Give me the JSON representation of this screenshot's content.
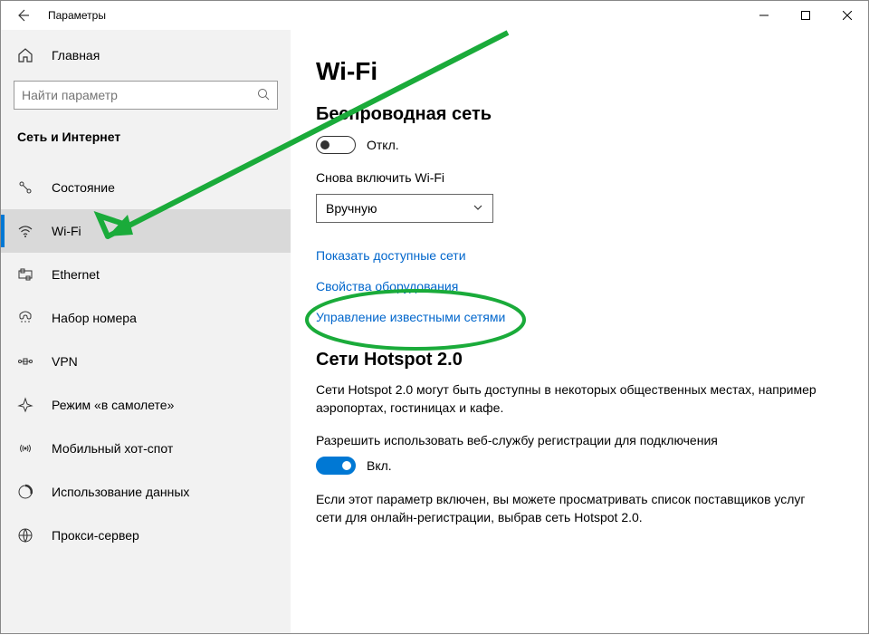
{
  "window_title": "Параметры",
  "home_label": "Главная",
  "search_placeholder": "Найти параметр",
  "section": "Сеть и Интернет",
  "sidebar": {
    "items": [
      {
        "label": "Состояние"
      },
      {
        "label": "Wi-Fi"
      },
      {
        "label": "Ethernet"
      },
      {
        "label": "Набор номера"
      },
      {
        "label": "VPN"
      },
      {
        "label": "Режим «в самолете»"
      },
      {
        "label": "Мобильный хот-спот"
      },
      {
        "label": "Использование данных"
      },
      {
        "label": "Прокси-сервер"
      }
    ]
  },
  "page": {
    "title": "Wi-Fi",
    "wireless_heading": "Беспроводная сеть",
    "wireless_toggle_state": "Откл.",
    "reconnect_label": "Снова включить Wi-Fi",
    "reconnect_value": "Вручную",
    "link_available": "Показать доступные сети",
    "link_hardware": "Свойства оборудования",
    "link_known": "Управление известными сетями",
    "hotspot_heading": "Сети Hotspot 2.0",
    "hotspot_intro": "Сети Hotspot 2.0 могут быть доступны в некоторых общественных местах, например аэропортах, гостиницах и кафе.",
    "hotspot_allow_label": "Разрешить использовать веб-службу регистрации для подключения",
    "hotspot_toggle_state": "Вкл.",
    "hotspot_desc": "Если этот параметр включен, вы можете просматривать список поставщиков услуг сети для онлайн-регистрации, выбрав сеть Hotspot 2.0."
  }
}
